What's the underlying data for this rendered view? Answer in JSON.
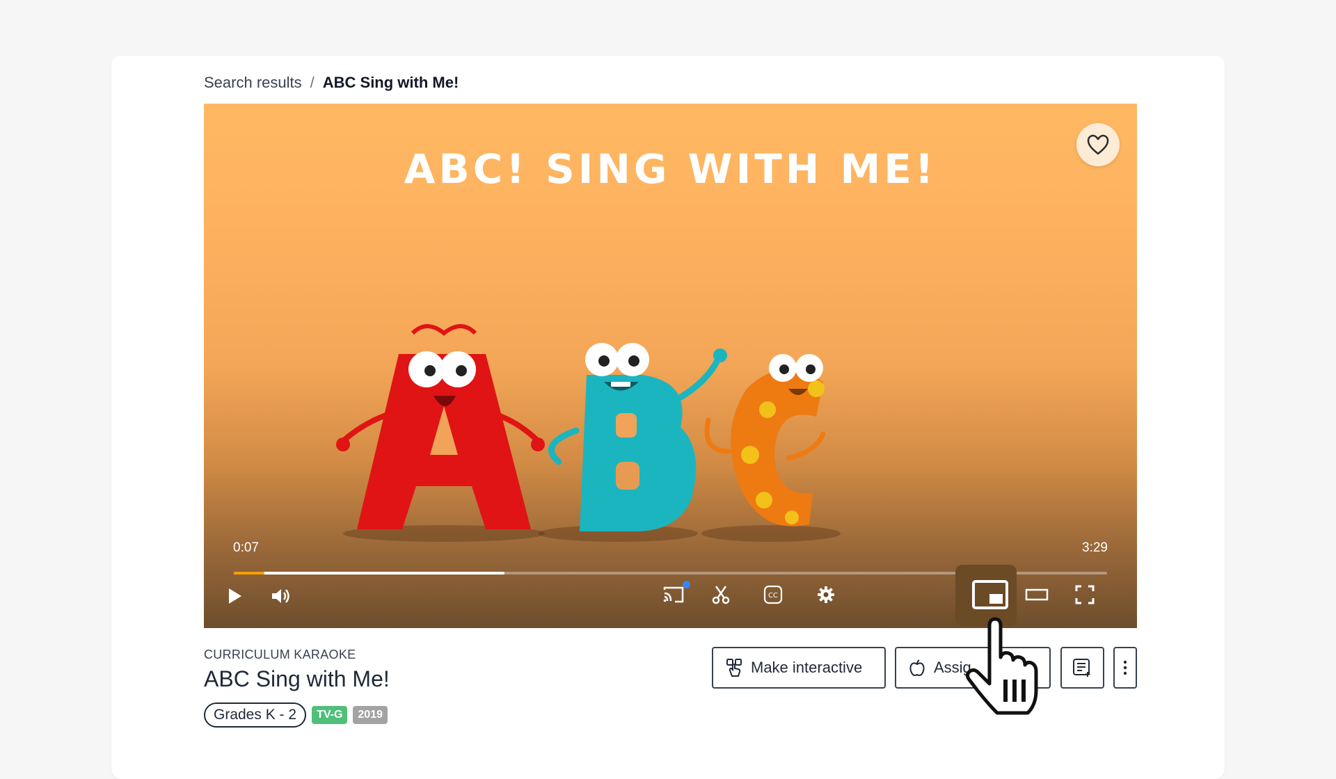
{
  "breadcrumb": {
    "parent": "Search results",
    "separator": "/",
    "current": "ABC Sing with Me!"
  },
  "video": {
    "overlay_title": "ABC! SING WITH ME!",
    "current_time": "0:07",
    "total_time": "3:29",
    "progress_played": 0.035,
    "progress_buffered": 0.31
  },
  "controls": [
    "play",
    "volume",
    "cast",
    "clip",
    "captions",
    "settings",
    "picture-in-picture",
    "theater",
    "fullscreen"
  ],
  "meta": {
    "series": "CURRICULUM KARAOKE",
    "title": "ABC Sing with Me!",
    "grade": "Grades K - 2",
    "rating": "TV-G",
    "year": "2019"
  },
  "actions": {
    "make_interactive": "Make interactive",
    "assign": "Assig"
  },
  "colors": {
    "accent": "#f59e0b",
    "rating_badge": "#4fbf7a",
    "year_badge": "#a3a3a3",
    "cast_dot": "#3b82f6"
  }
}
